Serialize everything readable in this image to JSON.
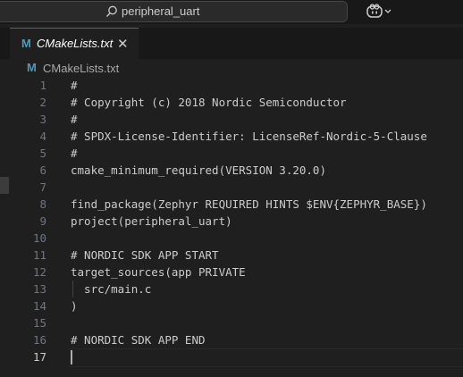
{
  "titlebar": {
    "search_text": "peripheral_uart"
  },
  "tabs": [
    {
      "icon_letter": "M",
      "label": "CMakeLists.txt",
      "close_glyph": "✕"
    }
  ],
  "breadcrumb": {
    "icon_letter": "M",
    "label": "CMakeLists.txt"
  },
  "editor": {
    "lines": [
      {
        "n": "1",
        "text": "#"
      },
      {
        "n": "2",
        "text": "# Copyright (c) 2018 Nordic Semiconductor"
      },
      {
        "n": "3",
        "text": "#"
      },
      {
        "n": "4",
        "text": "# SPDX-License-Identifier: LicenseRef-Nordic-5-Clause"
      },
      {
        "n": "5",
        "text": "#"
      },
      {
        "n": "6",
        "text": "cmake_minimum_required(VERSION 3.20.0)"
      },
      {
        "n": "7",
        "text": ""
      },
      {
        "n": "8",
        "text": "find_package(Zephyr REQUIRED HINTS $ENV{ZEPHYR_BASE})"
      },
      {
        "n": "9",
        "text": "project(peripheral_uart)"
      },
      {
        "n": "10",
        "text": ""
      },
      {
        "n": "11",
        "text": "# NORDIC SDK APP START"
      },
      {
        "n": "12",
        "text": "target_sources(app PRIVATE"
      },
      {
        "n": "13",
        "text": "  src/main.c"
      },
      {
        "n": "14",
        "text": ")"
      },
      {
        "n": "15",
        "text": ""
      },
      {
        "n": "16",
        "text": "# NORDIC SDK APP END"
      },
      {
        "n": "17",
        "text": ""
      }
    ],
    "active_line": "17"
  },
  "colors": {
    "accent": "#0078d4",
    "cmake_icon": "#519aba"
  }
}
